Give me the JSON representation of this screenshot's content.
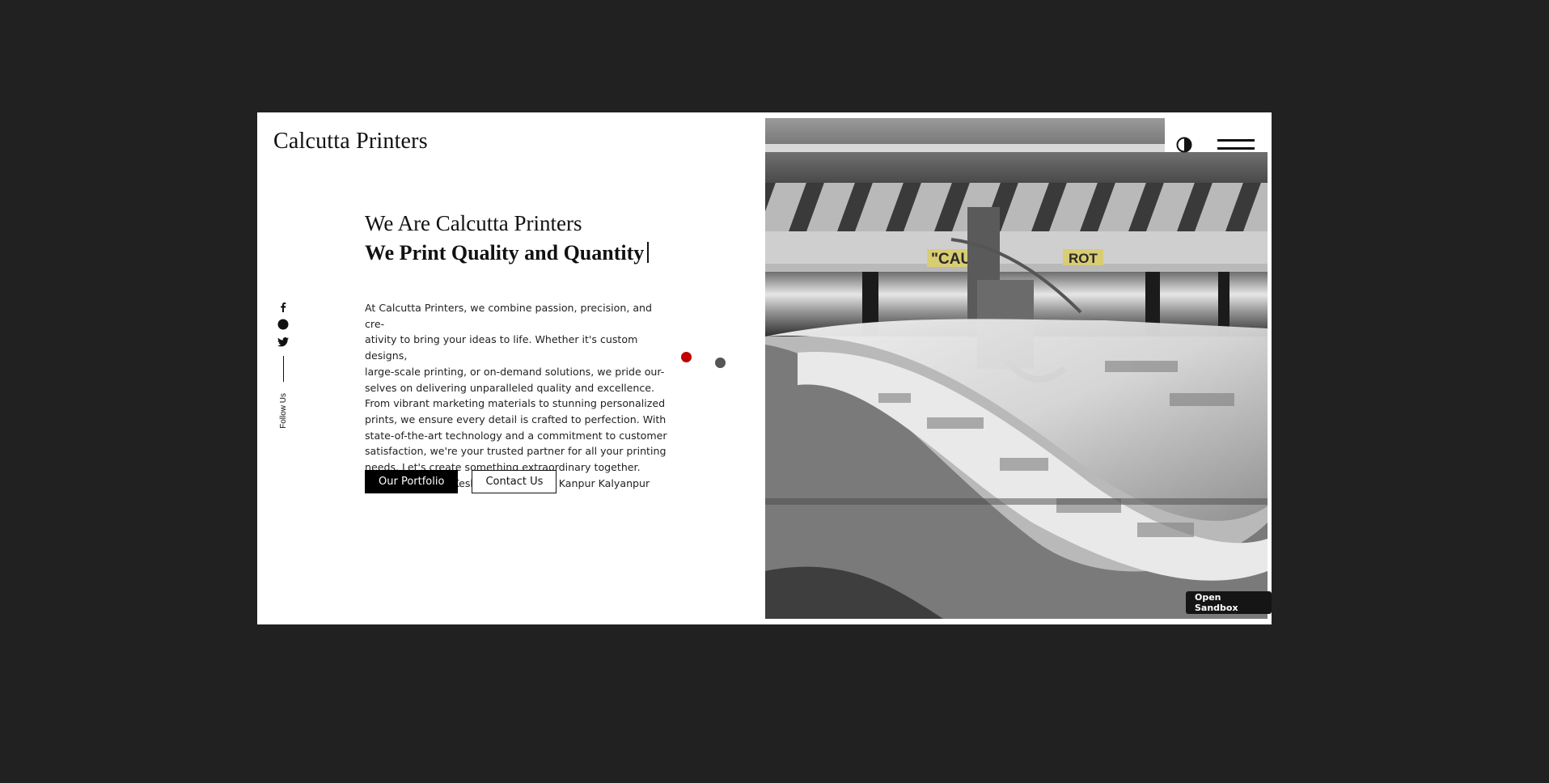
{
  "brand": {
    "title": "Calcutta Printers"
  },
  "hero": {
    "line1": "We Are Calcutta Printers",
    "line2": "We Print Quality and Quantity"
  },
  "about": {
    "lines": [
      "At Calcutta Printers, we combine passion, precision, and cre-",
      "ativity to bring your ideas to life. Whether it's custom designs,",
      "large-scale printing, or on-demand solutions, we pride our-",
      "selves on delivering unparalleled quality and excellence.",
      "From vibrant marketing materials to stunning personalized",
      "prints, we ensure every detail is crafted to perfection. With",
      "state-of-the-art technology and a commitment to customer",
      "satisfaction, we're your trusted partner for all your printing",
      "needs. Let's create something extraordinary together.",
      "Address: H-1084 Keshav Vatika Road, Kanpur Kalyanpur"
    ]
  },
  "buttons": {
    "portfolio": "Our Portfolio",
    "contact": "Contact Us"
  },
  "social": {
    "follow_label": "Follow Us",
    "icons": [
      "facebook-icon",
      "circle-icon",
      "twitter-icon"
    ]
  },
  "slider": {
    "active_color": "#c00000",
    "inactive_color": "#555555"
  },
  "header": {
    "icons": [
      "theme-toggle-icon",
      "hamburger-menu-icon"
    ]
  },
  "photo": {
    "labels": [
      "\"CAUTIO",
      "ROT"
    ]
  },
  "sandbox": {
    "label": "Open Sandbox"
  },
  "colors": {
    "background": "#212121",
    "frame": "#ffffff",
    "accent_red": "#c00000"
  }
}
